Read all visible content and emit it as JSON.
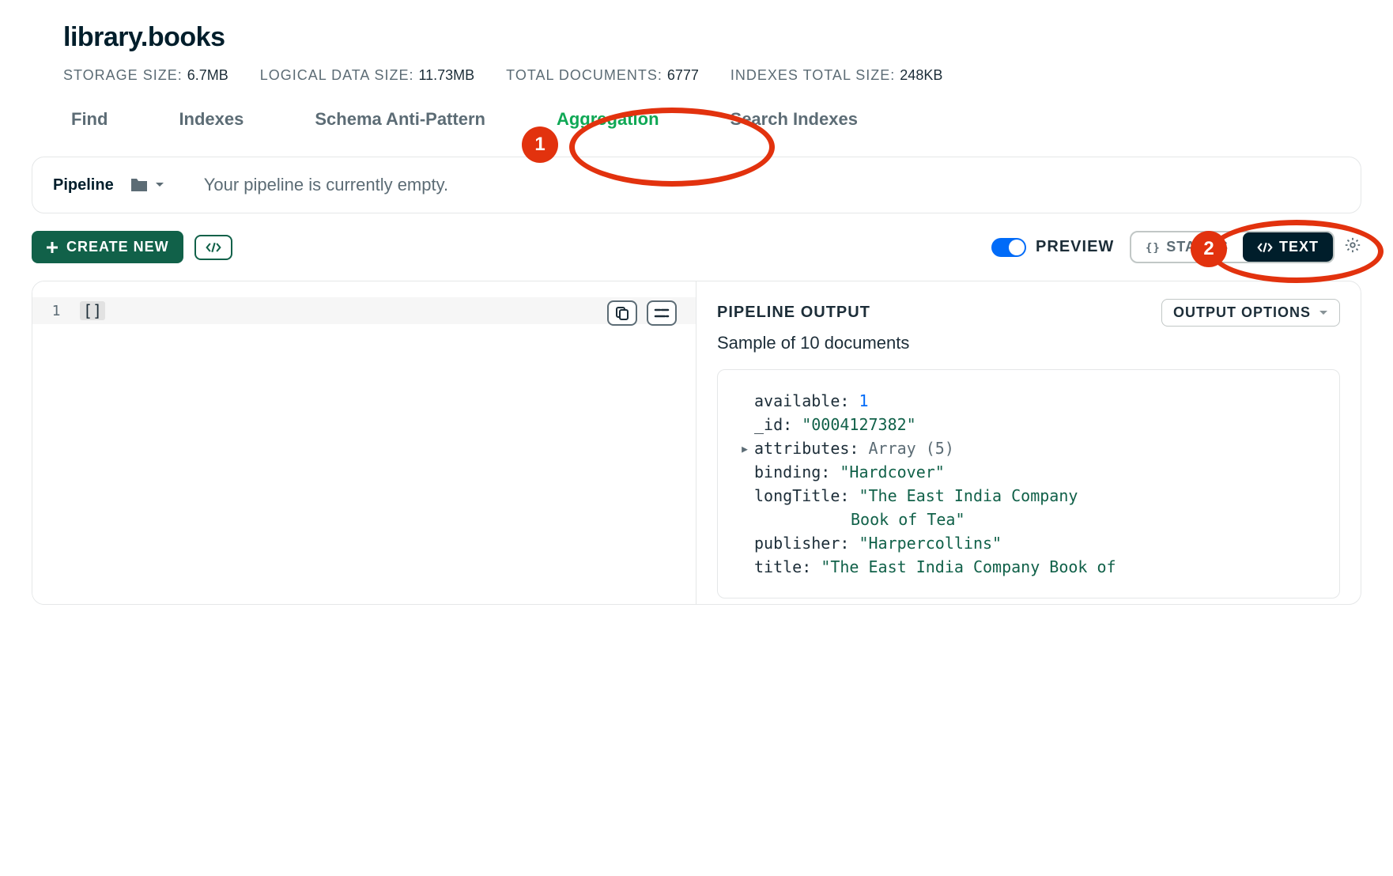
{
  "title": "library.books",
  "stats": {
    "storage_label": "STORAGE SIZE:",
    "storage_value": "6.7MB",
    "logical_label": "LOGICAL DATA SIZE:",
    "logical_value": "11.73MB",
    "docs_label": "TOTAL DOCUMENTS:",
    "docs_value": "6777",
    "idx_label": "INDEXES TOTAL SIZE:",
    "idx_value": "248KB"
  },
  "tabs": {
    "find": "Find",
    "indexes": "Indexes",
    "schema": "Schema Anti-Pattern",
    "aggregation": "Aggregation",
    "search": "Search Indexes"
  },
  "pipeline": {
    "label": "Pipeline",
    "empty": "Your pipeline is currently empty."
  },
  "controls": {
    "create_new": "CREATE NEW",
    "preview": "PREVIEW",
    "stages": "STAGES",
    "text": "TEXT"
  },
  "editor": {
    "line_num": "1",
    "line_content": "[]"
  },
  "output": {
    "title": "PIPELINE OUTPUT",
    "options_btn": "OUTPUT OPTIONS",
    "sample": "Sample of 10 documents",
    "doc": {
      "available_k": "available",
      "available_v": "1",
      "id_k": "_id",
      "id_v": "\"0004127382\"",
      "attributes_k": "attributes",
      "attributes_v": "Array (5)",
      "binding_k": "binding",
      "binding_v": "\"Hardcover\"",
      "longtitle_k": "longTitle",
      "longtitle_v1": "\"The East India Company",
      "longtitle_v2": "Book of Tea\"",
      "publisher_k": "publisher",
      "publisher_v": "\"Harpercollins\"",
      "title_k": "title",
      "title_v": "\"The East India Company Book of"
    }
  },
  "callouts": {
    "one": "1",
    "two": "2"
  }
}
